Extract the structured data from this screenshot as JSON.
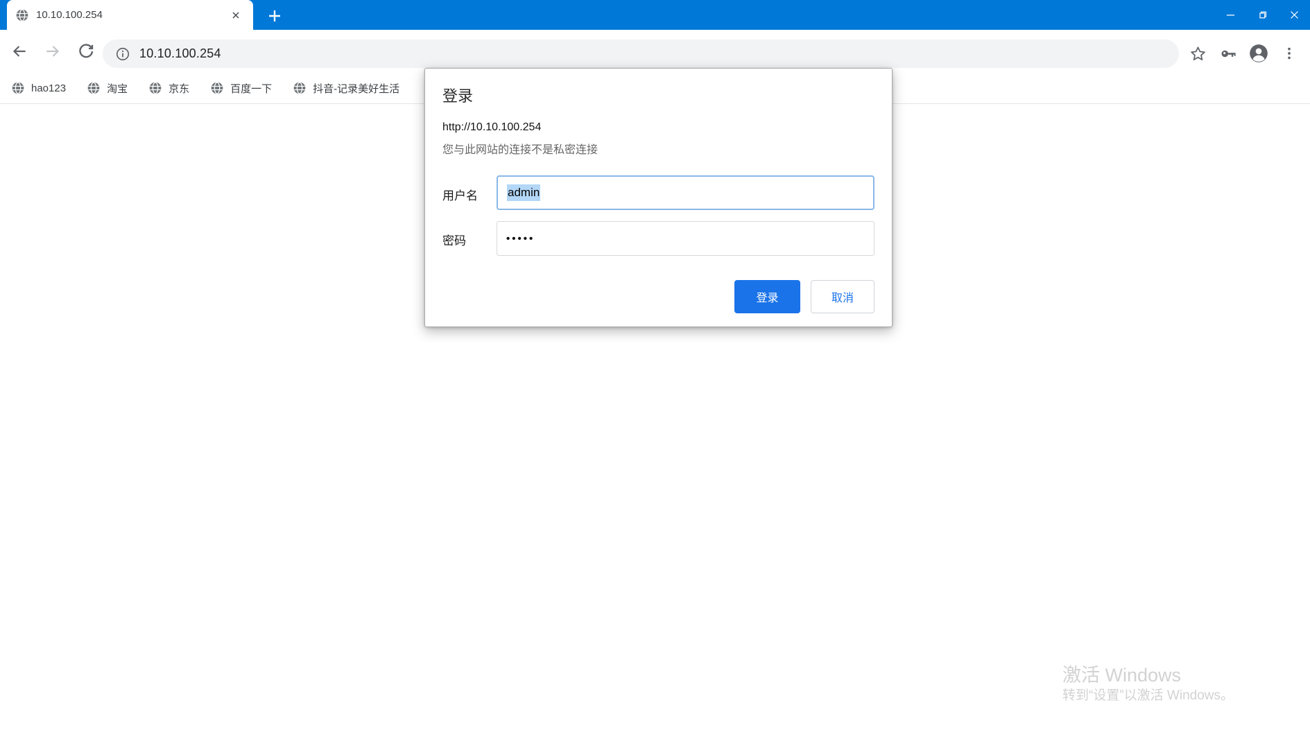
{
  "browser": {
    "tab_title": "10.10.100.254",
    "url": "10.10.100.254",
    "bookmarks": [
      "hao123",
      "淘宝",
      "京东",
      "百度一下",
      "抖音-记录美好生活"
    ]
  },
  "dialog": {
    "title": "登录",
    "origin": "http://10.10.100.254",
    "warning": "您与此网站的连接不是私密连接",
    "username": {
      "label": "用户名",
      "value": "admin"
    },
    "password": {
      "label": "密码",
      "value": "•••••"
    },
    "buttons": {
      "signin": "登录",
      "cancel": "取消"
    }
  },
  "watermark": {
    "line1": "激活 Windows",
    "line2": "转到“设置”以激活 Windows。"
  },
  "colors": {
    "titlebar_blue": "#0078d7",
    "primary_button_blue": "#1a73e8",
    "focus_border_blue": "#8ab8e8",
    "text_selection_blue": "#b3d7f7",
    "icon_gray": "#5f6368",
    "omnibox_gray": "#f1f3f4"
  }
}
